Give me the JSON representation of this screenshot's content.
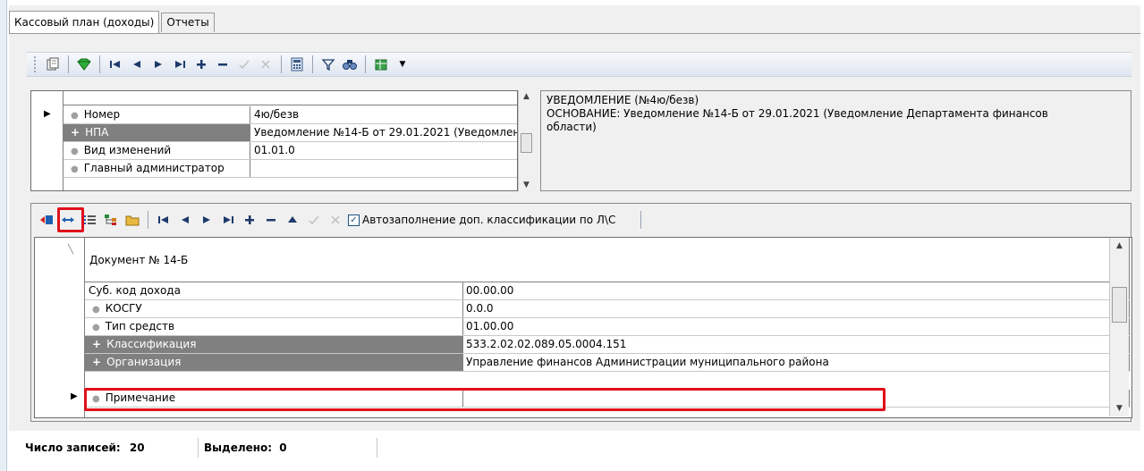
{
  "tabs": [
    {
      "label": "Кассовый план (доходы)",
      "active": true
    },
    {
      "label": "Отчеты",
      "active": false
    }
  ],
  "toolbar_top": {
    "icons": [
      "copy-icon",
      "gem-icon",
      "first-icon",
      "prev-icon",
      "next-icon",
      "last-icon",
      "add-icon",
      "remove-icon",
      "confirm-icon",
      "cancel-icon",
      "calculator-icon",
      "filter-icon",
      "find-icon",
      "export-icon",
      "dropdown-icon"
    ]
  },
  "header_grid": {
    "rows": [
      {
        "label": "Номер",
        "value": "4ю/безв",
        "kind": "bullet"
      },
      {
        "label": "НПА",
        "value": "Уведомление  №14-Б от 29.01.2021 (Уведомление Департамента финансов области)",
        "kind": "plus"
      },
      {
        "label": "Вид изменений",
        "value": "01.01.0",
        "kind": "bullet"
      },
      {
        "label": "Главный администратор",
        "value": "",
        "kind": "bullet"
      }
    ]
  },
  "note": {
    "line1": "УВЕДОМЛЕНИЕ  (№4ю/безв)",
    "line2": "ОСНОВАНИЕ: Уведомление  №14-Б от 29.01.2021 (Уведомление Департамента финансов",
    "line3": "области)"
  },
  "toolbar_detail": {
    "autofill_label": "Автозаполнение доп. классификации по Л\\С",
    "autofill_checked": true
  },
  "detail_grid": {
    "header": "Документ № 14-Б",
    "rows": [
      {
        "label": "Суб. код дохода",
        "value": "00.00.00",
        "kind": "plain"
      },
      {
        "label": "КОСГУ",
        "value": "0.0.0",
        "kind": "bullet"
      },
      {
        "label": "Тип средств",
        "value": "01.00.00",
        "kind": "bullet"
      },
      {
        "label": "Классификация",
        "value": "533.2.02.02.089.05.0004.151",
        "kind": "plus"
      },
      {
        "label": "Организация",
        "value": "Управление финансов Администрации муниципального района",
        "kind": "plus"
      },
      {
        "label": "Примечание",
        "value": "",
        "kind": "bullet"
      }
    ]
  },
  "status": {
    "count_label": "Число записей:",
    "count_value": "20",
    "selected_label": "Выделено:",
    "selected_value": "0"
  },
  "colors": {
    "highlight": "#e0101a",
    "dark_row": "#808080",
    "toolbar_blue": "#1c5180"
  }
}
